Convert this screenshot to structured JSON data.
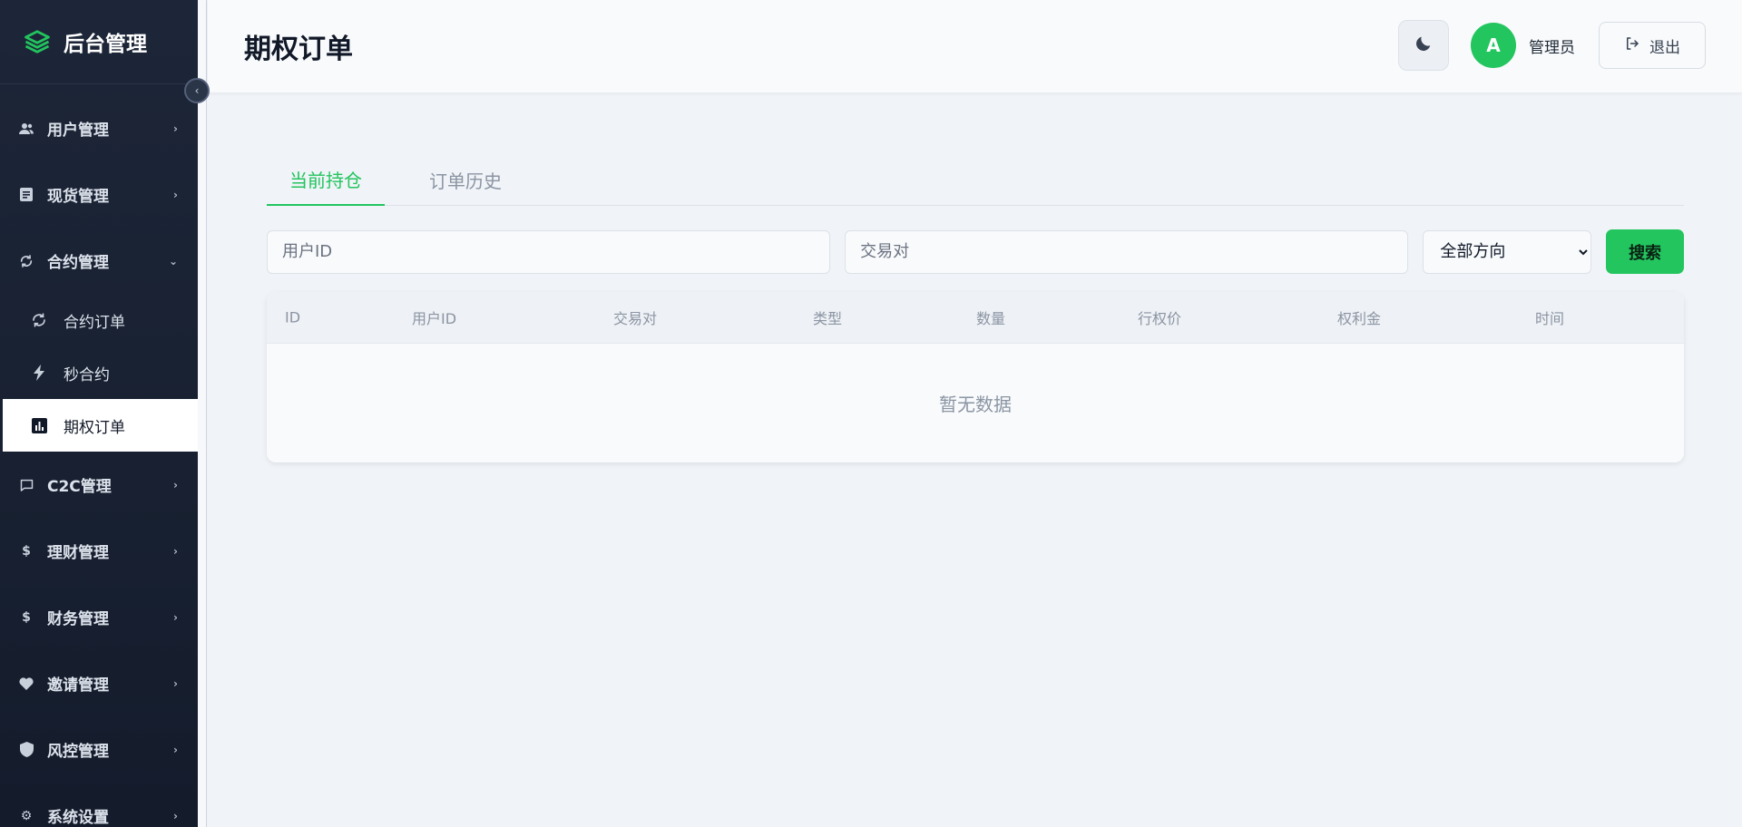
{
  "brand": {
    "title": "后台管理"
  },
  "sidebar": {
    "items": [
      {
        "label": "用户管理",
        "icon": "users-icon"
      },
      {
        "label": "现货管理",
        "icon": "document-icon"
      },
      {
        "label": "合约管理",
        "icon": "refresh-icon",
        "expanded": true,
        "children": [
          {
            "label": "合约订单",
            "icon": "refresh-icon"
          },
          {
            "label": "秒合约",
            "icon": "bolt-icon"
          },
          {
            "label": "期权订单",
            "icon": "bar-chart-icon",
            "active": true
          }
        ]
      },
      {
        "label": "C2C管理",
        "icon": "chat-icon"
      },
      {
        "label": "理财管理",
        "icon": "dollar-icon"
      },
      {
        "label": "财务管理",
        "icon": "dollar-icon"
      },
      {
        "label": "邀请管理",
        "icon": "heart-icon"
      },
      {
        "label": "风控管理",
        "icon": "shield-icon"
      },
      {
        "label": "系统设置",
        "icon": "gear-icon"
      }
    ]
  },
  "header": {
    "title": "期权订单",
    "avatar_letter": "A",
    "user_name": "管理员",
    "logout_label": "退出"
  },
  "tabs": [
    {
      "label": "当前持仓",
      "active": true
    },
    {
      "label": "订单历史",
      "active": false
    }
  ],
  "filters": {
    "user_id_placeholder": "用户ID",
    "pair_placeholder": "交易对",
    "direction_selected": "全部方向",
    "search_label": "搜索"
  },
  "table": {
    "columns": [
      "ID",
      "用户ID",
      "交易对",
      "类型",
      "数量",
      "行权价",
      "权利金",
      "时间"
    ],
    "rows": [],
    "empty_text": "暂无数据"
  },
  "colors": {
    "accent": "#22c55e",
    "sidebar_bg": "#1d2638",
    "page_bg": "#f0f3f7"
  }
}
